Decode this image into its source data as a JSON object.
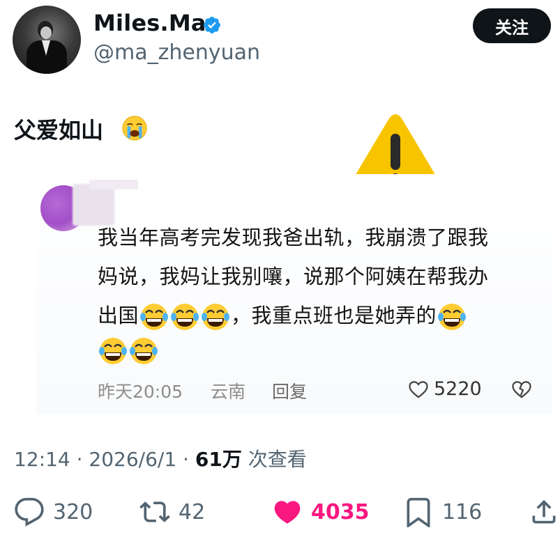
{
  "header": {
    "display_name": "Miles.Ma",
    "handle": "@ma_zhenyuan",
    "follow_label": "关注",
    "verified_color": "#1d9bf0"
  },
  "post": {
    "text": "父爱如山",
    "emoji": "loudly-crying-face"
  },
  "overlay": {
    "icon": "warning-icon",
    "color": "#f8c400"
  },
  "comment": {
    "line1": "我当年高考完发现我爸出轨，我崩溃了跟我",
    "line2": "妈说，我妈让我别嚷，说那个阿姨在帮我办",
    "line3_a": "出国",
    "line3_b": "，我重点班也是她弄的",
    "time": "昨天20:05",
    "location": "云南",
    "reply_label": "回复",
    "like_count": "5220"
  },
  "stamp": {
    "time": "12:14",
    "sep1": " · ",
    "date": "2026/6/1",
    "sep2": " · ",
    "views": "61万",
    "views_label": " 次查看"
  },
  "actions": {
    "replies": "320",
    "retweets": "42",
    "likes": "4035",
    "bookmarks": "116",
    "like_color": "#f91880"
  }
}
